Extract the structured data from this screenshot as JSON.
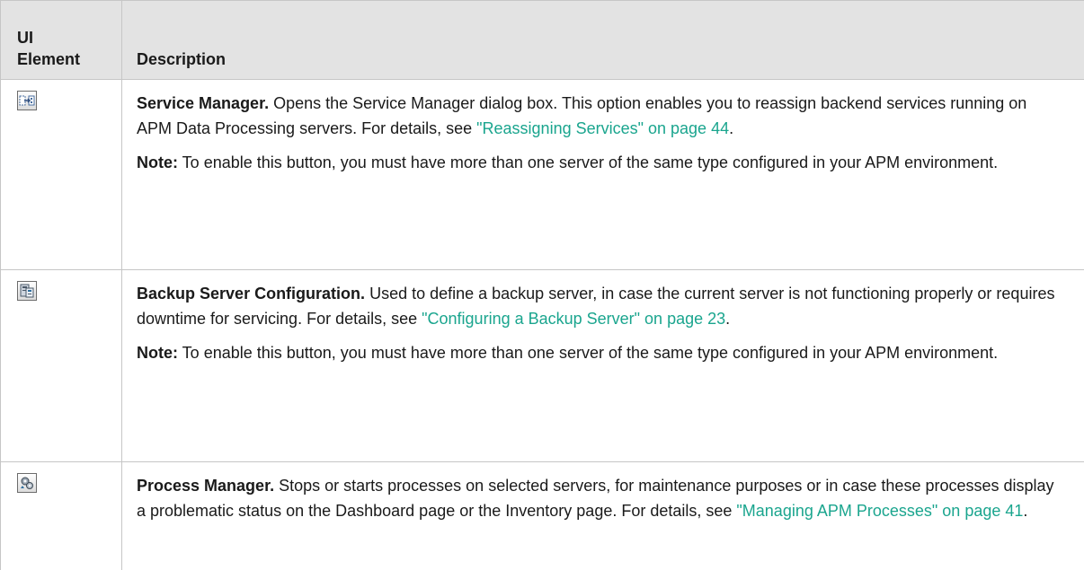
{
  "header": {
    "col1_line1": "UI",
    "col1_line2": "Element",
    "col2": "Description"
  },
  "rows": [
    {
      "icon": "service-manager-icon",
      "title": "Service Manager.",
      "text": " Opens the Service Manager dialog box. This option enables you to reassign backend services running on APM Data Processing servers. For details, see ",
      "link": "\"Reassigning Services\" on page 44",
      "after_link": ".",
      "note_label": "Note:",
      "note_text": " To enable this button, you must have more than one server of the same type configured in your APM environment."
    },
    {
      "icon": "backup-server-icon",
      "title": "Backup Server Configuration.",
      "text": " Used to define a backup server, in case the current server is not functioning properly or requires downtime for servicing. For details, see ",
      "link": "\"Configuring a Backup Server\" on page 23",
      "after_link": ".",
      "note_label": "Note:",
      "note_text": " To enable this button, you must have more than one server of the same type configured in your APM environment."
    },
    {
      "icon": "process-manager-icon",
      "title": "Process Manager.",
      "text": " Stops or starts processes on selected servers, for maintenance purposes or in case these processes display a problematic status on the Dashboard page or the Inventory page. For details, see ",
      "link": "\"Managing APM Processes\" on page 41",
      "after_link": "."
    }
  ],
  "colors": {
    "header_bg": "#e3e3e3",
    "border": "#c6c6c6",
    "link": "#1aa58e"
  }
}
